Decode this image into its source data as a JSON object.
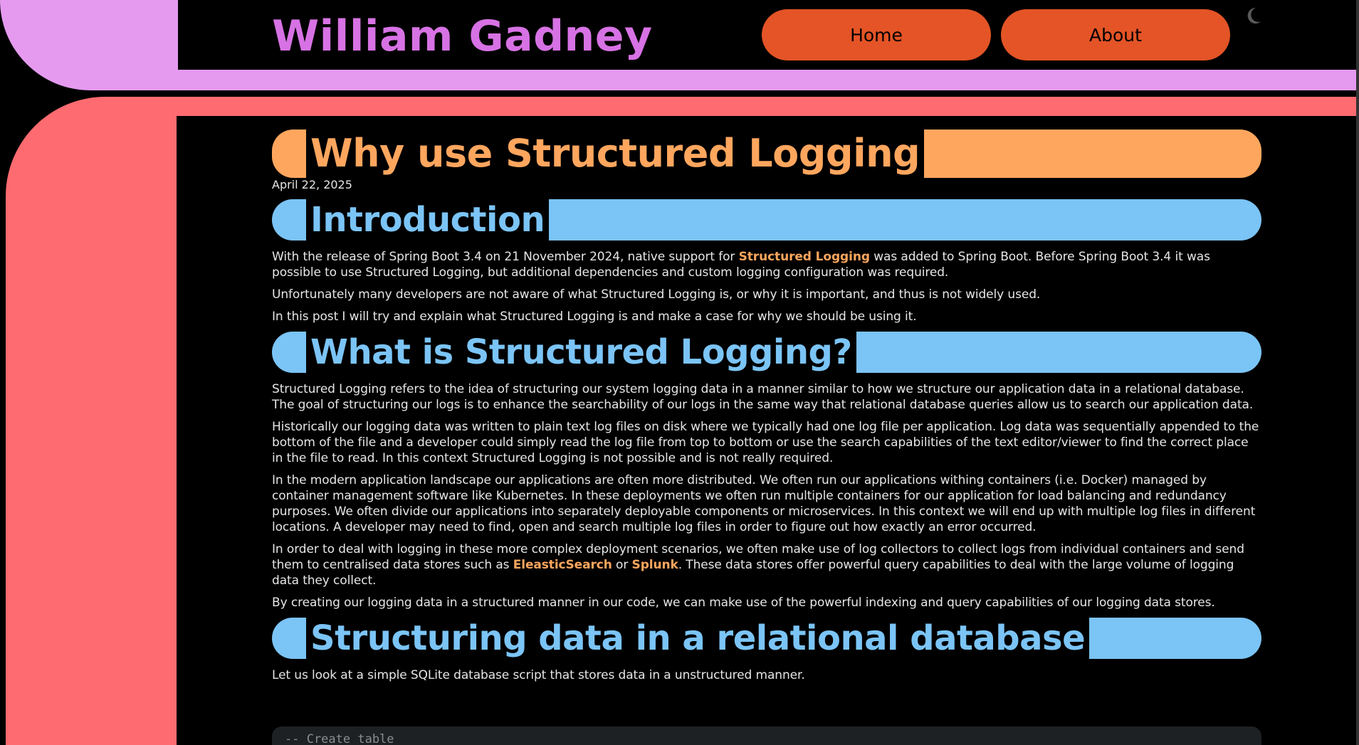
{
  "header": {
    "site_title": "William Gadney",
    "nav": [
      {
        "label": "Home"
      },
      {
        "label": "About"
      }
    ],
    "theme_icon": "moon-icon"
  },
  "article": {
    "title": "Why use Structured Logging",
    "date": "April 22, 2025",
    "sections": [
      {
        "heading": "Introduction",
        "paragraphs": [
          {
            "before": "With the release of Spring Boot 3.4 on 21 November 2024, native support for ",
            "link": "Structured Logging",
            "after": " was added to Spring Boot. Before Spring Boot 3.4 it was possible to use Structured Logging, but additional dependencies and custom logging configuration was required."
          },
          {
            "text": "Unfortunately many developers are not aware of what Structured Logging is, or why it is important, and thus is not widely used."
          },
          {
            "text": "In this post I will try and explain what Structured Logging is and make a case for why we should be using it."
          }
        ]
      },
      {
        "heading": "What is Structured Logging?",
        "paragraphs": [
          {
            "text": "Structured Logging refers to the idea of structuring our system logging data in a manner similar to how we structure our application data in a relational database. The goal of structuring our logs is to enhance the searchability of our logs in the same way that relational database queries allow us to search our application data."
          },
          {
            "text": "Historically our logging data was written to plain text log files on disk where we typically had one log file per application. Log data was sequentially appended to the bottom of the file and a developer could simply read the log file from top to bottom or use the search capabilities of the text editor/viewer to find the correct place in the file to read. In this context Structured Logging is not possible and is not really required."
          },
          {
            "text": "In the modern application landscape our applications are often more distributed. We often run our applications withing containers (i.e. Docker) managed by container management software like Kubernetes. In these deployments we often run multiple containers for our application for load balancing and redundancy purposes. We often divide our applications into separately deployable components or microservices. In this context we will end up with multiple log files in different locations. A developer may need to find, open and search multiple log files in order to figure out how exactly an error occurred."
          },
          {
            "before": "In order to deal with logging in these more complex deployment scenarios, we often make use of log collectors to collect logs from individual containers and send them to centralised data stores such as ",
            "link": "EleasticSearch",
            "middle": " or ",
            "link2": "Splunk",
            "after": ". These data stores offer powerful query capabilities to deal with the large volume of logging data they collect."
          },
          {
            "text": "By creating our logging data in a structured manner in our code, we can make use of the powerful indexing and query capabilities of our logging data stores."
          }
        ]
      },
      {
        "heading": "Structuring data in a relational database",
        "paragraphs": [
          {
            "text": "Let us look at a simple SQLite database script that stores data in a unstructured manner."
          }
        ]
      }
    ],
    "code_first_line": "-- Create table"
  },
  "colors": {
    "frame_top": "#e59aef",
    "frame_side": "#fe6b70",
    "title_color": "#d772e4",
    "nav_button": "#e45426",
    "h1_accent": "#ffa65e",
    "h2_accent": "#7bc4f6",
    "link": "#ffa65e"
  }
}
